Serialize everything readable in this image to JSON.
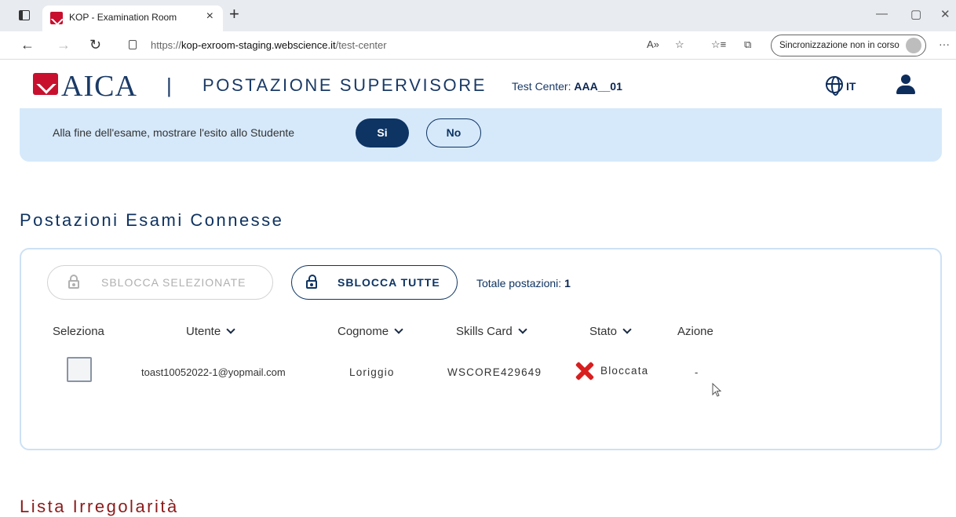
{
  "browser": {
    "tab_title": "KOP - Examination Room",
    "tab_close": "×",
    "new_tab": "+",
    "url_prefix": "https://",
    "url_host": "kop-exroom-staging.webscience.it",
    "url_path": "/test-center",
    "sync_label": "Sincronizzazione non in corso",
    "window_controls": [
      "—",
      "▢",
      "✕"
    ]
  },
  "header": {
    "logo": "AICA",
    "separator": "|",
    "title": "POSTAZIONE SUPERVISORE",
    "test_center_label": "Test Center:",
    "test_center_value": "AAA__01",
    "language": "IT"
  },
  "banner": {
    "text": "Alla fine dell'esame, mostrare l'esito allo Studente",
    "yes_label": "Si",
    "no_label": "No"
  },
  "section": {
    "title": "Postazioni Esami Connesse"
  },
  "actions": {
    "unlock_selected": "SBLOCCA SELEZIONATE",
    "unlock_all": "SBLOCCA TUTTE",
    "total_label": "Totale postazioni:",
    "total_value": "1"
  },
  "table": {
    "headers": {
      "select": "Seleziona",
      "user": "Utente",
      "surname": "Cognome",
      "skills_card": "Skills Card",
      "status": "Stato",
      "action": "Azione"
    },
    "rows": [
      {
        "user": "toast10052022-1@yopmail.com",
        "surname": "Loriggio",
        "skills_card": "WSCORE429649",
        "status": "Bloccata",
        "action": "-"
      }
    ]
  },
  "irregularities": {
    "title": "Lista Irregolarità"
  },
  "colors": {
    "navy": "#0d3463",
    "banner_bg": "#d6e9fb",
    "error_red": "#d81e1e",
    "accent_red": "#c8102e"
  }
}
